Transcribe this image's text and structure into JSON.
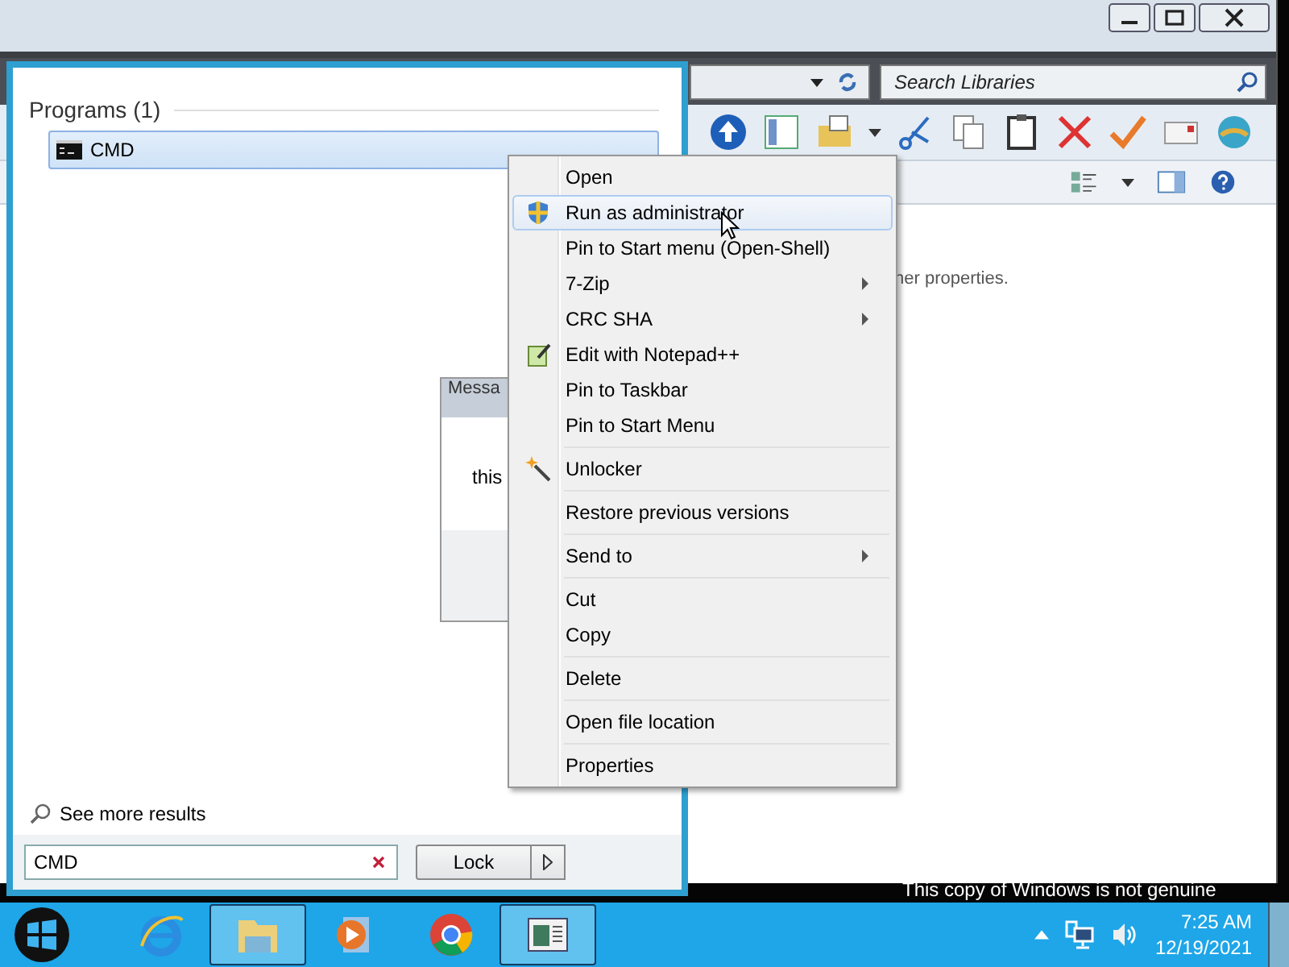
{
  "explorer": {
    "search": {
      "placeholder": "Search Libraries"
    },
    "details_text": "her properties."
  },
  "message_box": {
    "title": "Messa",
    "text": "this"
  },
  "start_menu": {
    "section_title": "Programs (1)",
    "results": [
      {
        "label": "CMD",
        "selected": true
      }
    ],
    "see_more": "See more results",
    "search": {
      "value": "CMD"
    },
    "power_button": "Lock"
  },
  "context_menu": {
    "groups": [
      [
        {
          "label": "Open",
          "kind": "plain",
          "selected": false,
          "submenu": false
        },
        {
          "label": "Run as administrator",
          "kind": "shield",
          "selected": true,
          "submenu": false
        },
        {
          "label": "Pin to Start menu (Open-Shell)",
          "kind": "plain",
          "selected": false,
          "submenu": false
        },
        {
          "label": "7-Zip",
          "kind": "plain",
          "selected": false,
          "submenu": true
        },
        {
          "label": "CRC SHA",
          "kind": "plain",
          "selected": false,
          "submenu": true
        },
        {
          "label": "Edit with Notepad++",
          "kind": "notepad",
          "selected": false,
          "submenu": false
        },
        {
          "label": "Pin to Taskbar",
          "kind": "plain",
          "selected": false,
          "submenu": false
        },
        {
          "label": "Pin to Start Menu",
          "kind": "plain",
          "selected": false,
          "submenu": false
        }
      ],
      [
        {
          "label": "Unlocker",
          "kind": "wand",
          "selected": false,
          "submenu": false
        }
      ],
      [
        {
          "label": "Restore previous versions",
          "kind": "plain",
          "selected": false,
          "submenu": false
        }
      ],
      [
        {
          "label": "Send to",
          "kind": "plain",
          "selected": false,
          "submenu": true
        }
      ],
      [
        {
          "label": "Cut",
          "kind": "plain",
          "selected": false,
          "submenu": false
        },
        {
          "label": "Copy",
          "kind": "plain",
          "selected": false,
          "submenu": false
        }
      ],
      [
        {
          "label": "Delete",
          "kind": "plain",
          "selected": false,
          "submenu": false
        }
      ],
      [
        {
          "label": "Open file location",
          "kind": "plain",
          "selected": false,
          "submenu": false
        }
      ],
      [
        {
          "label": "Properties",
          "kind": "plain",
          "selected": false,
          "submenu": false
        }
      ]
    ]
  },
  "genuine_notice": "This copy of Windows is not genuine",
  "taskbar": {
    "apps": [
      {
        "kind": "browser-e",
        "active": false
      },
      {
        "kind": "folder",
        "active": true
      },
      {
        "kind": "media",
        "active": false
      },
      {
        "kind": "chrome",
        "active": false
      },
      {
        "kind": "window",
        "active": true
      }
    ],
    "clock": {
      "time": "7:25 AM",
      "date": "12/19/2021"
    }
  }
}
